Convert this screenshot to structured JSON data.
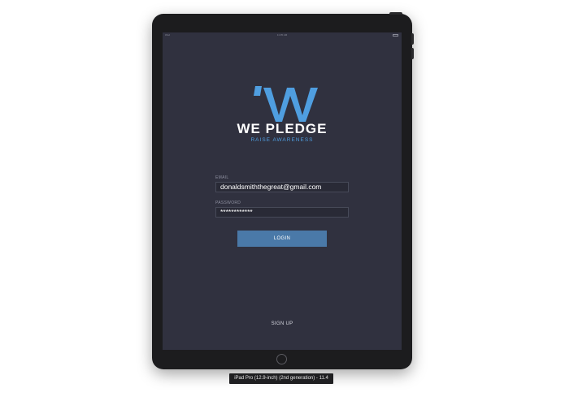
{
  "status_bar": {
    "carrier": "iPad",
    "time": "11:35 AM"
  },
  "app": {
    "brand": "WE PLEDGE",
    "tagline": "RAISE AWARENESS",
    "colors": {
      "background": "#30313f",
      "accent": "#4f9ee0",
      "button": "#4a79a8"
    }
  },
  "login_form": {
    "email_label": "EMAIL",
    "email_value": "donaldsmiththegreat@gmail.com",
    "password_label": "PASSWORD",
    "password_value": "************",
    "login_label": "LOGIN",
    "signup_label": "SIGN UP"
  },
  "simulator": {
    "caption": "iPad Pro (12.9-inch) (2nd generation) - 11.4"
  }
}
